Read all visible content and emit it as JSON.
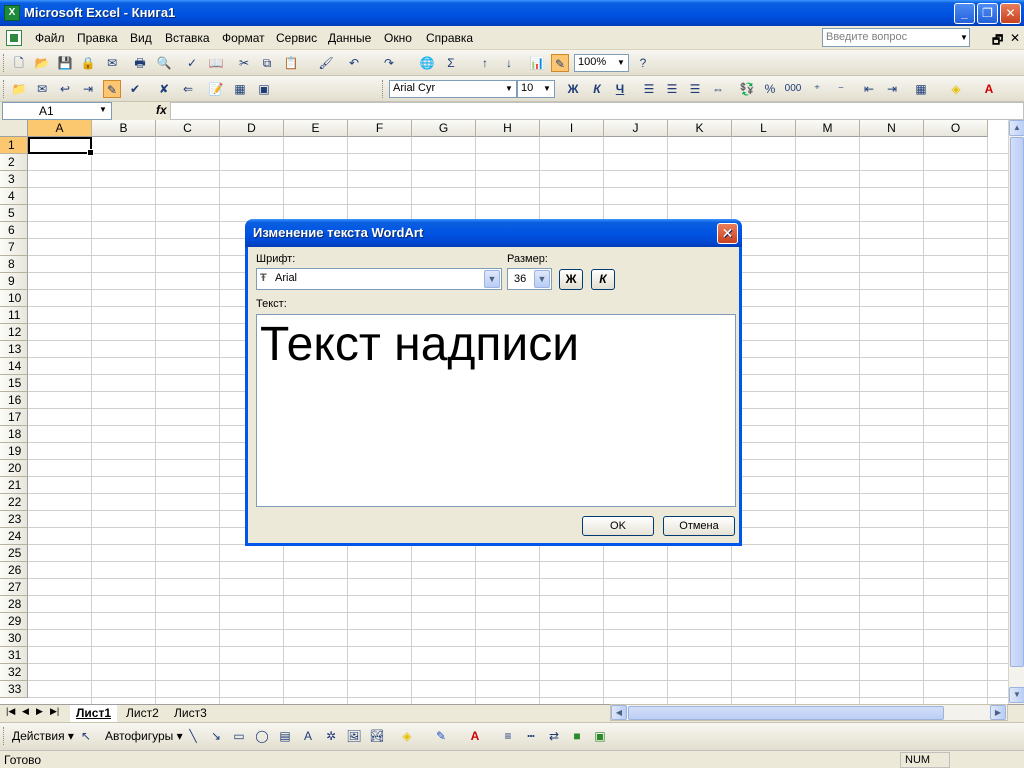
{
  "window": {
    "title": "Microsoft Excel - Книга1",
    "app_icon_letter": "X",
    "minimize": "_",
    "restore": "❐",
    "close": "✕"
  },
  "menu": {
    "items": [
      "Файл",
      "Правка",
      "Вид",
      "Вставка",
      "Формат",
      "Сервис",
      "Данные",
      "Окно",
      "Справка"
    ],
    "help_placeholder": "Введите вопрос",
    "mdi_restore": "🗗",
    "mdi_close": "✕"
  },
  "toolbar": {
    "zoom": "100%",
    "font_name": "Arial Cyr",
    "font_size": "10",
    "bold": "Ж",
    "italic": "К",
    "underline": "Ч",
    "percent": "%",
    "thousands": "000"
  },
  "formula_bar": {
    "name_box": "A1",
    "fx": "fx",
    "formula": ""
  },
  "grid": {
    "columns": [
      "A",
      "B",
      "C",
      "D",
      "E",
      "F",
      "G",
      "H",
      "I",
      "J",
      "K",
      "L",
      "M",
      "N",
      "O"
    ],
    "rows": [
      "1",
      "2",
      "3",
      "4",
      "5",
      "6",
      "7",
      "8",
      "9",
      "10",
      "11",
      "12",
      "13",
      "14",
      "15",
      "16",
      "17",
      "18",
      "19",
      "20",
      "21",
      "22",
      "23",
      "24",
      "25",
      "26",
      "27",
      "28",
      "29",
      "30",
      "31",
      "32",
      "33"
    ],
    "active_cell": "A1"
  },
  "sheets": {
    "tabs": [
      "Лист1",
      "Лист2",
      "Лист3"
    ],
    "active": "Лист1"
  },
  "drawing_toolbar": {
    "actions": "Действия",
    "autoshapes": "Автофигуры"
  },
  "status": {
    "text": "Готово",
    "num": "NUM"
  },
  "dialog": {
    "title": "Изменение текста WordArt",
    "font_label": "Шрифт:",
    "font_value": "Arial",
    "size_label": "Размер:",
    "size_value": "36",
    "bold_label": "Ж",
    "italic_label": "К",
    "text_label": "Текст:",
    "text_value": "Текст надписи",
    "ok_label": "OK",
    "cancel_label": "Отмена"
  },
  "colors": {
    "title_bar": "#0054e3",
    "selection": "#fbc870",
    "dialog_border": "#0055ea"
  }
}
